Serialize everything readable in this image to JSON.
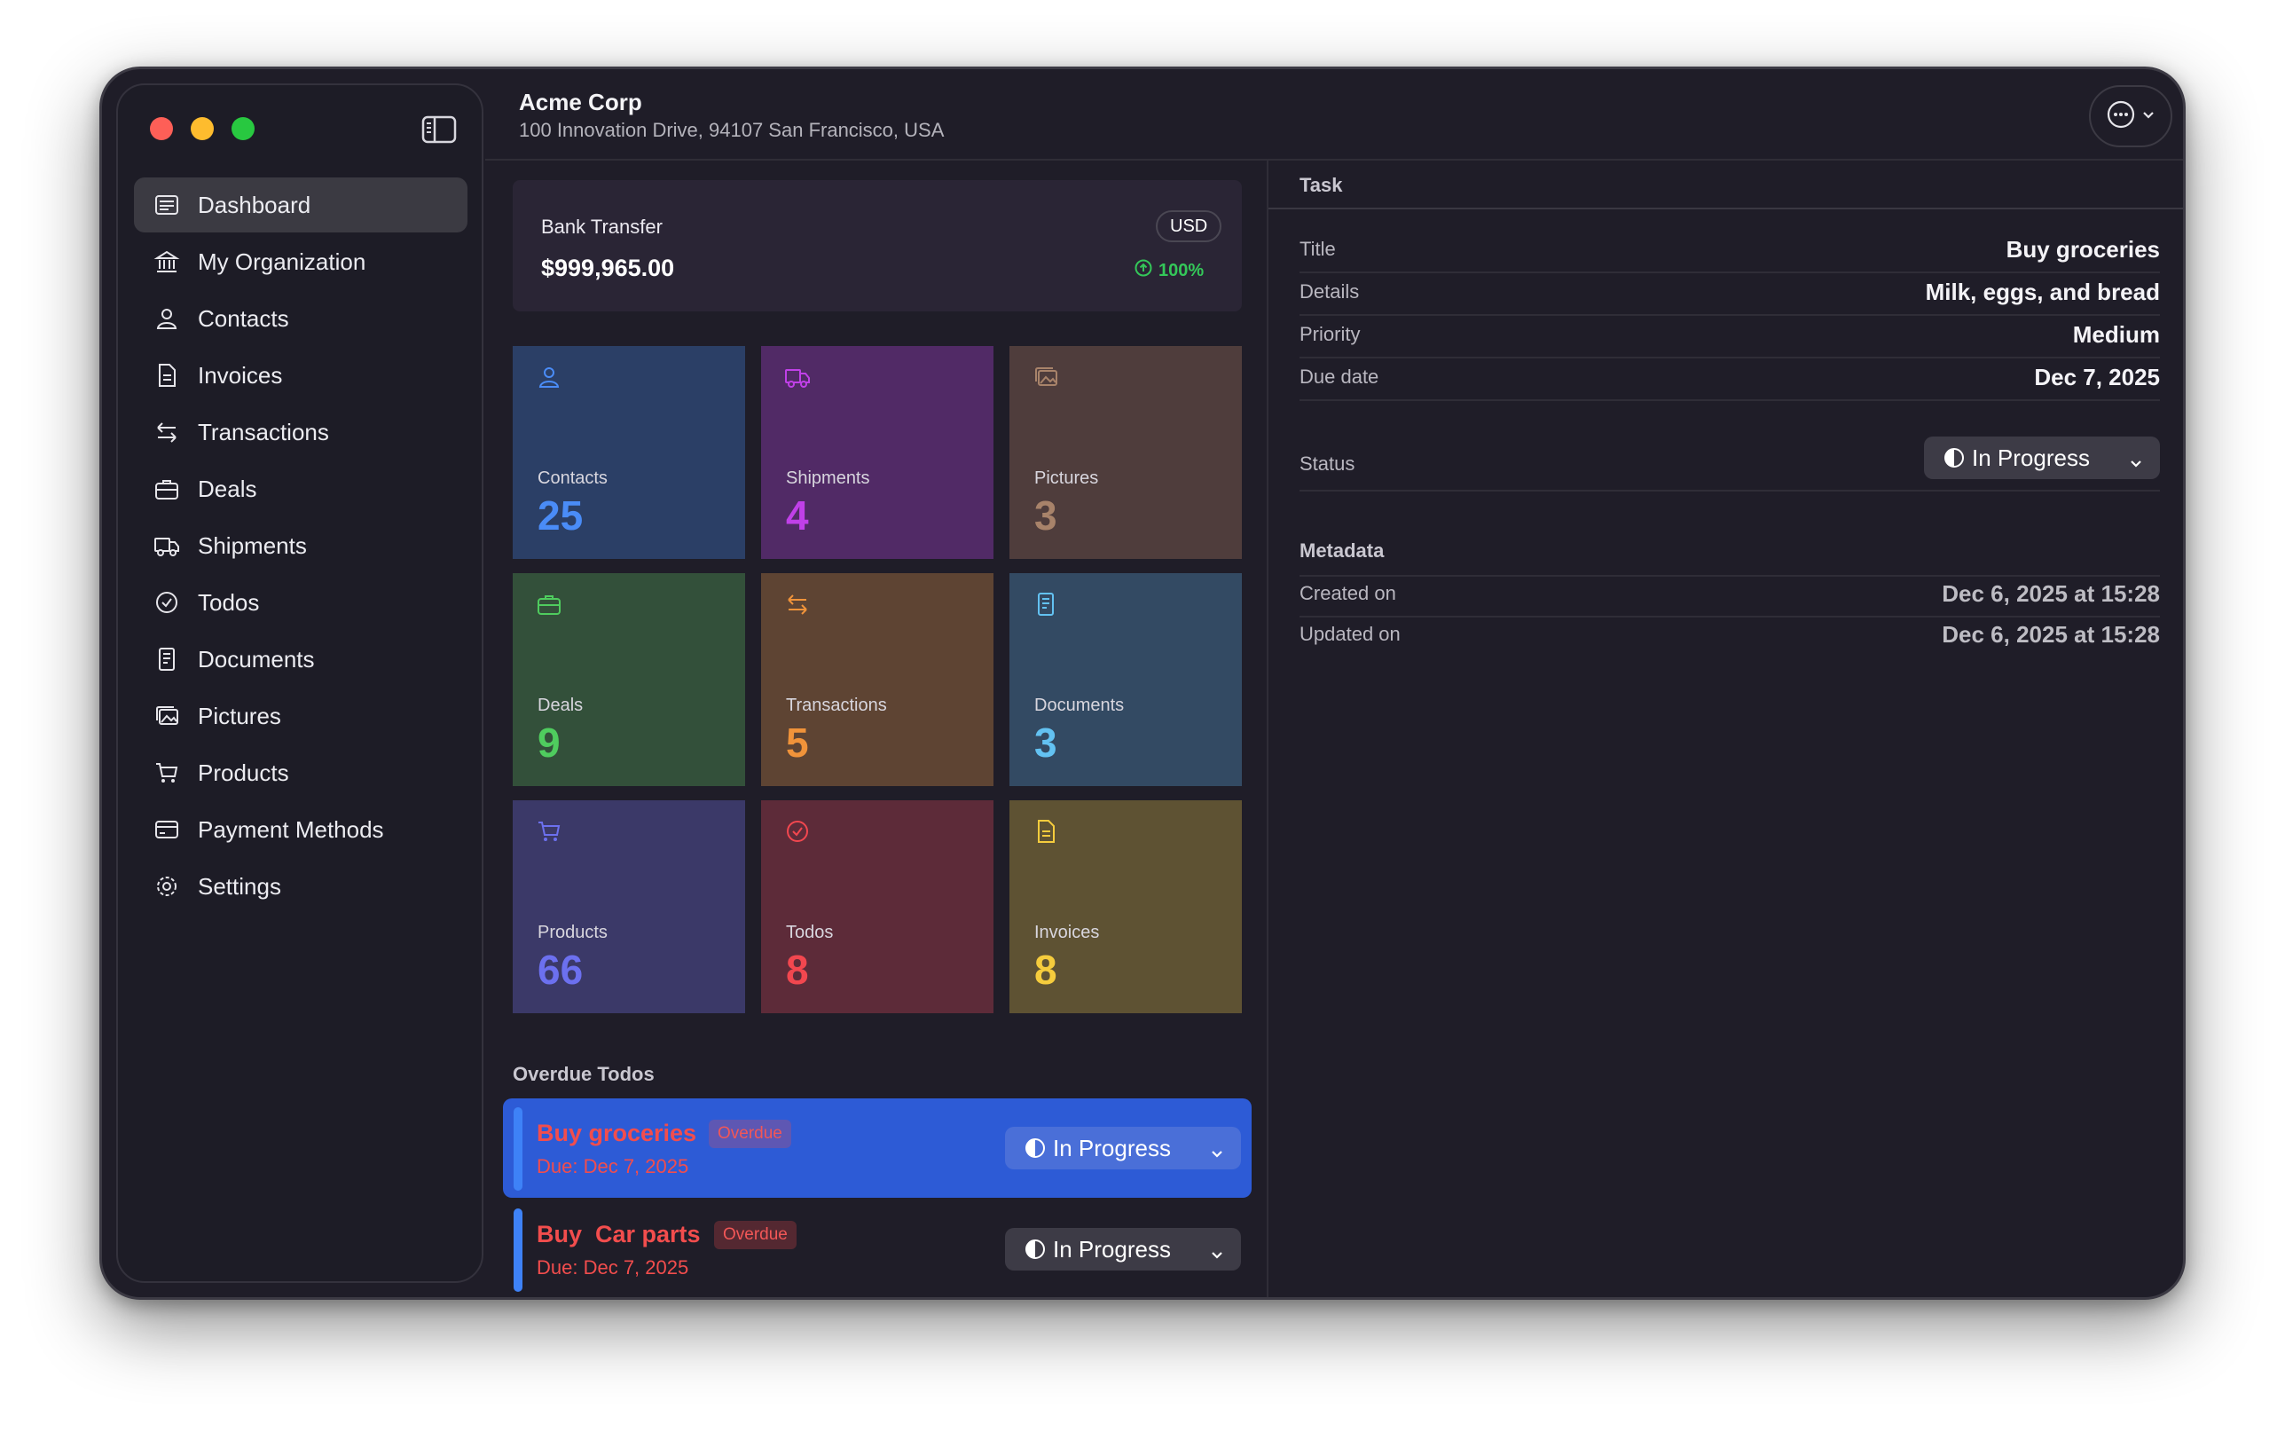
{
  "header": {
    "title": "Acme Corp",
    "subtitle": "100 Innovation Drive, 94107 San Francisco, USA"
  },
  "sidebar": {
    "items": [
      {
        "label": "Dashboard",
        "icon": "dashboard-icon",
        "active": true
      },
      {
        "label": "My Organization",
        "icon": "bank-icon"
      },
      {
        "label": "Contacts",
        "icon": "person-icon"
      },
      {
        "label": "Invoices",
        "icon": "invoice-icon"
      },
      {
        "label": "Transactions",
        "icon": "arrows-icon"
      },
      {
        "label": "Deals",
        "icon": "briefcase-icon"
      },
      {
        "label": "Shipments",
        "icon": "truck-icon"
      },
      {
        "label": "Todos",
        "icon": "check-circle-icon"
      },
      {
        "label": "Documents",
        "icon": "document-icon"
      },
      {
        "label": "Pictures",
        "icon": "photos-icon"
      },
      {
        "label": "Products",
        "icon": "cart-icon"
      },
      {
        "label": "Payment Methods",
        "icon": "credit-card-icon"
      },
      {
        "label": "Settings",
        "icon": "gear-icon"
      }
    ]
  },
  "bank": {
    "label": "Bank Transfer",
    "amount": "$999,965.00",
    "currency": "USD",
    "percent": "100%",
    "percent_color": "#34c759"
  },
  "tiles": [
    {
      "label": "Contacts",
      "count": "25",
      "bg": "#2b3f66",
      "accent": "#4a8cf7",
      "icon": "person-icon"
    },
    {
      "label": "Shipments",
      "count": "4",
      "bg": "#512a66",
      "accent": "#c040e8",
      "icon": "truck-icon"
    },
    {
      "label": "Pictures",
      "count": "3",
      "bg": "#4f3d3c",
      "accent": "#a8836a",
      "icon": "photos-icon"
    },
    {
      "label": "Deals",
      "count": "9",
      "bg": "#33503a",
      "accent": "#4fcc5e",
      "icon": "briefcase-icon"
    },
    {
      "label": "Transactions",
      "count": "5",
      "bg": "#5e4433",
      "accent": "#f0933a",
      "icon": "arrows-icon"
    },
    {
      "label": "Documents",
      "count": "3",
      "bg": "#334a63",
      "accent": "#63c2f2",
      "icon": "document-icon"
    },
    {
      "label": "Products",
      "count": "66",
      "bg": "#3b3968",
      "accent": "#6c70ef",
      "icon": "cart-icon"
    },
    {
      "label": "Todos",
      "count": "8",
      "bg": "#5d2b39",
      "accent": "#f2474f",
      "icon": "check-circle-icon"
    },
    {
      "label": "Invoices",
      "count": "8",
      "bg": "#5e5233",
      "accent": "#f5cc3d",
      "icon": "invoice-icon"
    }
  ],
  "overdue": {
    "title": "Overdue Todos",
    "items": [
      {
        "title": "Buy groceries",
        "badge": "Overdue",
        "due": "Due: Dec 7, 2025",
        "status": "In Progress",
        "selected": true
      },
      {
        "title": "Buy  Car parts",
        "badge": "Overdue",
        "due": "Due: Dec 7, 2025",
        "status": "In Progress",
        "selected": false
      }
    ]
  },
  "detail": {
    "section": "Task",
    "fields": [
      {
        "key": "Title",
        "value": "Buy groceries"
      },
      {
        "key": "Details",
        "value": "Milk, eggs, and bread"
      },
      {
        "key": "Priority",
        "value": "Medium"
      },
      {
        "key": "Due date",
        "value": "Dec 7, 2025"
      }
    ],
    "status_label": "Status",
    "status_value": "In Progress",
    "metadata_title": "Metadata",
    "metadata": [
      {
        "key": "Created on",
        "value": "Dec 6, 2025 at 15:28"
      },
      {
        "key": "Updated on",
        "value": "Dec 6, 2025 at 15:28"
      }
    ]
  }
}
